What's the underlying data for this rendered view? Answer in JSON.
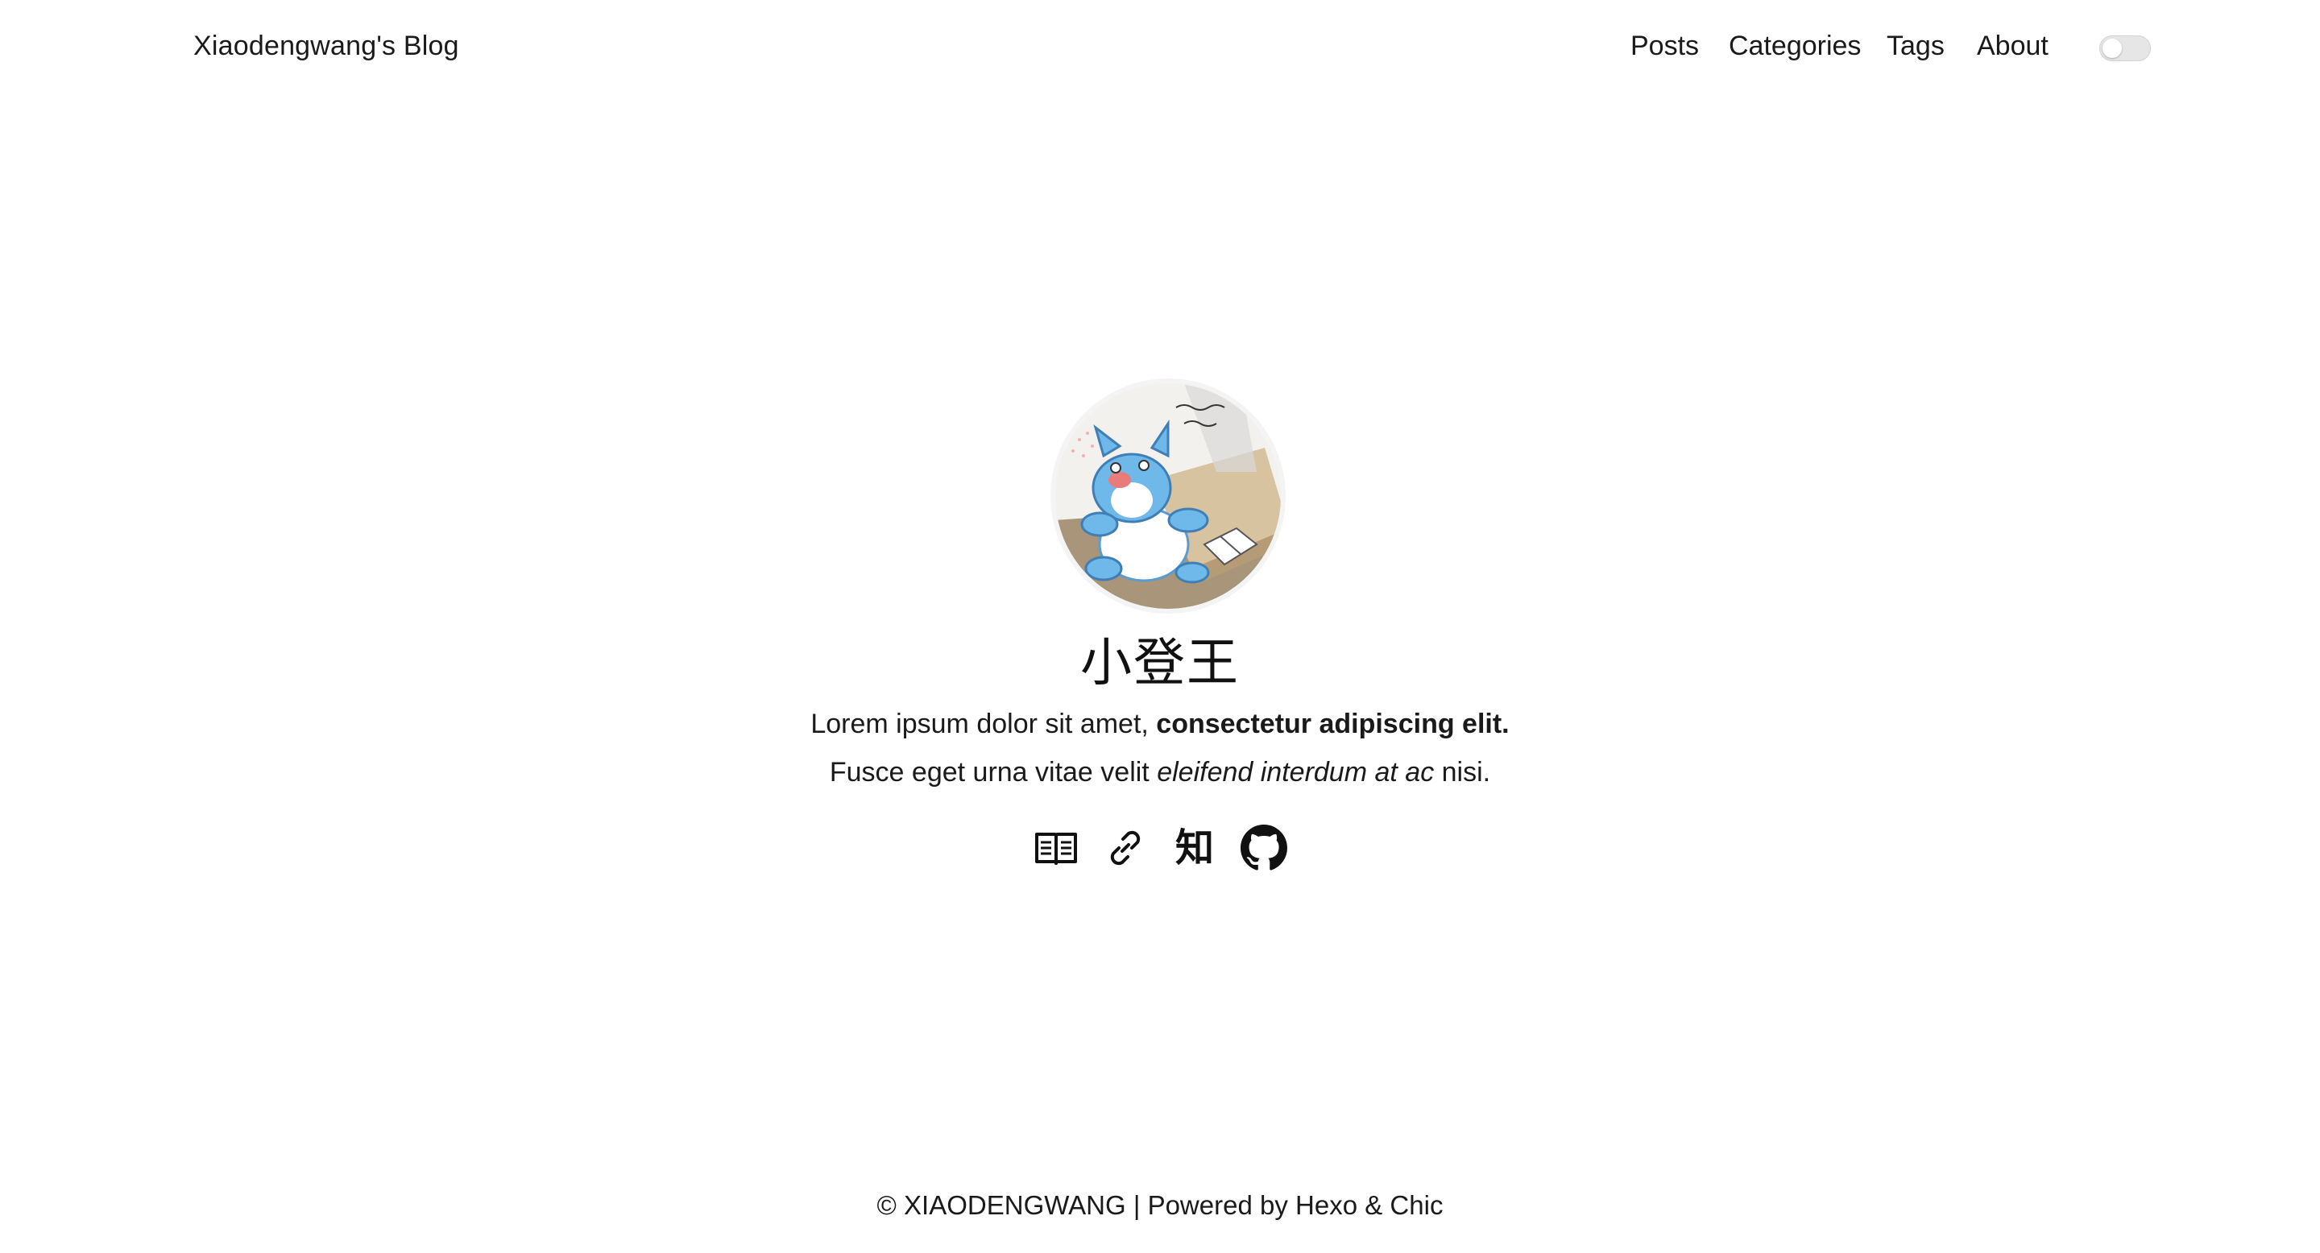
{
  "header": {
    "site_title": "Xiaodengwang's Blog",
    "nav": [
      {
        "label": "Posts"
      },
      {
        "label": "Categories"
      },
      {
        "label": "Tags"
      },
      {
        "label": "About"
      }
    ],
    "theme_toggle": {
      "state": "off"
    }
  },
  "profile": {
    "avatar_icon": "cartoon-avatar",
    "name": "小登王",
    "desc_line1_plain": "Lorem ipsum dolor sit amet, ",
    "desc_line1_bold": "consectetur adipiscing elit.",
    "desc_line2_plain_a": "Fusce eget urna vitae velit ",
    "desc_line2_italic": "eleifend interdum at ac",
    "desc_line2_plain_b": " nisi.",
    "social": [
      {
        "icon": "book-icon"
      },
      {
        "icon": "link-icon"
      },
      {
        "icon": "zhihu-icon",
        "glyph": "知"
      },
      {
        "icon": "github-icon"
      }
    ]
  },
  "footer": {
    "copyright": "© XIAODENGWANG | Powered by ",
    "hexo": "Hexo",
    "amp": " & ",
    "chic": "Chic"
  },
  "colors": {
    "text": "#1a1a1a",
    "background": "#ffffff",
    "avatar_blue": "#6fb8ea"
  }
}
